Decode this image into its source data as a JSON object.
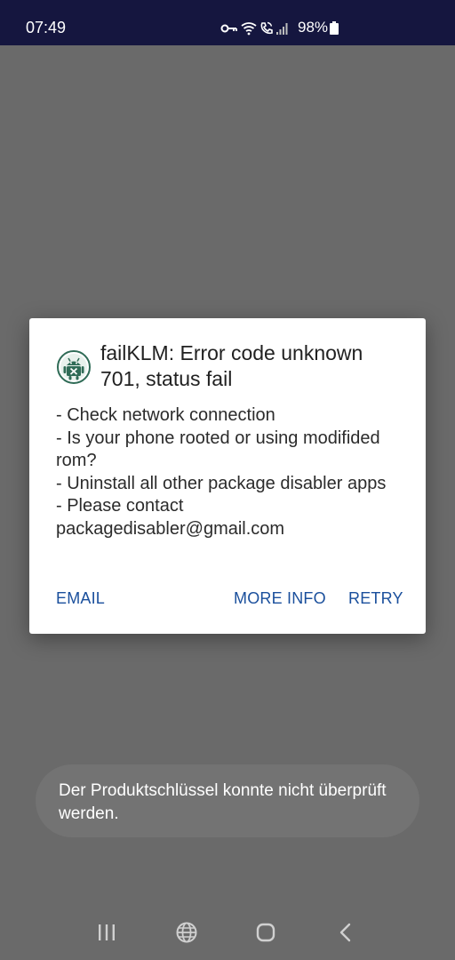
{
  "status_bar": {
    "time": "07:49",
    "battery_percent": "98%",
    "icons": [
      "vpn-key-icon",
      "wifi-icon",
      "wifi-call-icon",
      "signal-icon",
      "battery-icon"
    ]
  },
  "dialog": {
    "icon": "package-disabler-app-icon",
    "title": "failKLM: Error code unknown 701, status fail",
    "message": "- Check network connection\n- Is your phone rooted or using modifided rom?\n- Uninstall all other package disabler apps\n- Please contact packagedisabler@gmail.com",
    "buttons": {
      "email": "EMAIL",
      "more_info": "MORE INFO",
      "retry": "RETRY"
    }
  },
  "toast": {
    "text": "Der Produktschlüssel konnte nicht überprüft werden."
  },
  "nav_bar": {
    "icons": [
      "recent-apps-icon",
      "globe-icon",
      "home-icon",
      "back-icon"
    ]
  },
  "colors": {
    "status_bar_bg": "#15163f",
    "scrim": "#6a6a6a",
    "dialog_button_text": "#1a4f9c",
    "toast_bg": "#737373"
  }
}
